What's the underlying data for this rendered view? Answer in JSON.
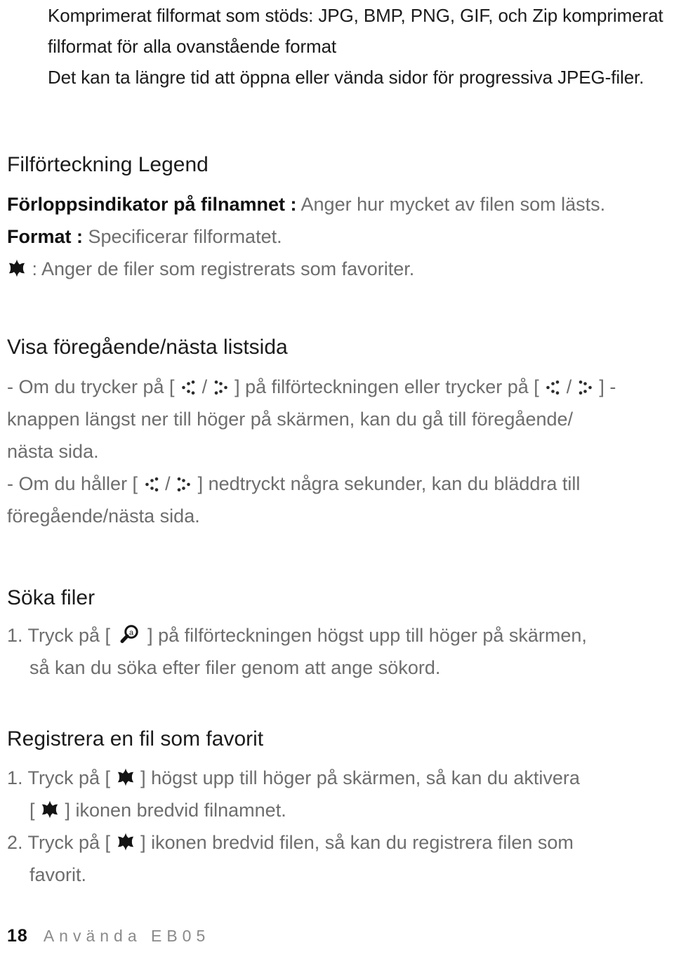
{
  "intro": {
    "lines": [
      "Komprimerat filformat som stöds: JPG, BMP, PNG, GIF, och Zip komprimerat",
      "filformat för alla ovanstående format",
      "Det kan ta längre tid att öppna eller vända sidor för progressiva JPEG-filer."
    ]
  },
  "legend": {
    "heading": "Filförteckning Legend",
    "rows": [
      {
        "term": "Förloppsindikator på filnamnet :",
        "desc": " Anger hur mycket av filen som lästs."
      },
      {
        "term": "Format :",
        "desc": " Specificerar filformatet."
      }
    ],
    "star_row": {
      "icon": "star-icon",
      "desc": " : Anger de filer som registrerats som favoriter."
    }
  },
  "prev_next": {
    "heading": "Visa föregående/nästa listsida",
    "line1_a": "- Om du trycker på [ ",
    "line1_sep": " / ",
    "line1_b": " ] på filförteckningen eller trycker på [ ",
    "line1_c": " ] -",
    "line2": "knappen längst ner till höger på skärmen, kan du gå till föregående/",
    "line3": "nästa sida.",
    "line4_a": "- Om du håller [ ",
    "line4_b": " ] nedtryckt några sekunder, kan du bläddra till",
    "line5": "föregående/nästa sida.",
    "icons": {
      "prev": "arrow-left-dots-icon",
      "next": "arrow-right-dots-icon"
    }
  },
  "search": {
    "heading": "Söka filer",
    "step1_a": "1. Tryck på [ ",
    "step1_b": " ] på filförteckningen högst upp till höger på skärmen,",
    "step1_cont": "så kan du söka efter filer genom att ange sökord.",
    "icon": "magnifier-a-icon"
  },
  "favorite": {
    "heading": "Registrera en fil som favorit",
    "step1_a": "1. Tryck på [ ",
    "step1_b": " ] högst upp till höger på skärmen, så kan du aktivera",
    "step1_cont_a": "[ ",
    "step1_cont_b": " ] ikonen bredvid filnamnet.",
    "step2_a": "2. Tryck på [ ",
    "step2_b": " ] ikonen bredvid filen, så kan du registrera filen som",
    "step2_cont": "favorit.",
    "icon": "star-icon"
  },
  "footer": {
    "page_number": "18",
    "label": "Använda EB05"
  },
  "colors": {
    "body_text": "#6d6d6d",
    "heading_text": "#1b1b1b",
    "bold_text": "#111111",
    "footer_label": "#8a8a8a",
    "background": "#ffffff"
  }
}
